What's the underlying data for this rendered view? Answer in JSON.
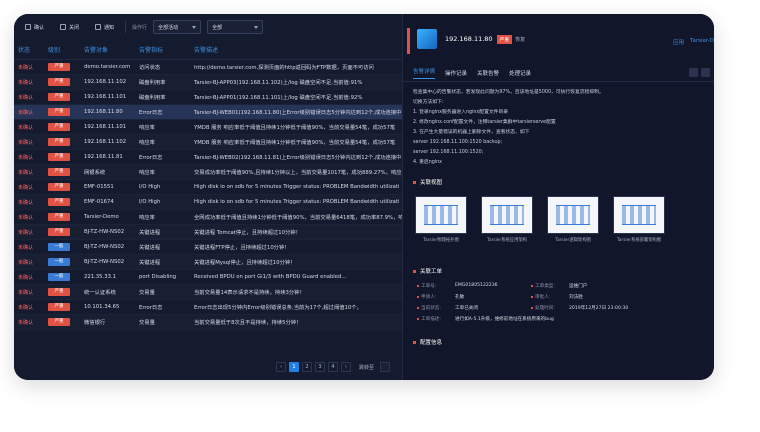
{
  "toolbar": {
    "confirm": "确认",
    "close": "关闭",
    "notify": "通知",
    "operate_label": "操作行",
    "filter1": "全部活动",
    "filter2": "全部"
  },
  "table": {
    "headers": [
      "状态",
      "级别",
      "告警对象",
      "告警指标",
      "告警描述"
    ],
    "rows": [
      {
        "status": "未确认",
        "level": "严重",
        "level_kind": "r",
        "object": "demo.tarsier.com",
        "metric": "访问状态",
        "desc": "http://demo.tarsier.com,探测页面的http返回码为FTP数据，页面不可访问",
        "selected": false
      },
      {
        "status": "未确认",
        "level": "严重",
        "level_kind": "r",
        "object": "192.168.11.102",
        "metric": "磁盘利用率",
        "desc": "Tarsier-BJ-APP03(192.168.11.102)上/log 磁盘空间不足,当前值:91%",
        "selected": false
      },
      {
        "status": "未确认",
        "level": "严重",
        "level_kind": "r",
        "object": "192.168.11.101",
        "metric": "磁盘利用率",
        "desc": "Tarsier-BJ-APP01(192.168.11.101)上/log 磁盘空间不足,当前值:92%",
        "selected": false
      },
      {
        "status": "未确认",
        "level": "严重",
        "level_kind": "r",
        "object": "192.168.11.80",
        "metric": "Error日志",
        "desc": "Tarsier-BJ-WEB01(192.168.11.80)上Error级别错误日志5分钟内达到12个,成功连接中...",
        "selected": true
      },
      {
        "status": "未确认",
        "level": "严重",
        "level_kind": "r",
        "object": "192.168.11.101",
        "metric": "响应率",
        "desc": "YMDB 服务 响应率低于阈值且持续1分钟低于阈值90%，当前交易量54笔，成功57笔",
        "selected": false
      },
      {
        "status": "未确认",
        "level": "严重",
        "level_kind": "r",
        "object": "192.168.11.102",
        "metric": "响应率",
        "desc": "YMDB 服务 响应率低于阈值且持续1分钟低于阈值90%，当前交易量54笔，成功57笔",
        "selected": false
      },
      {
        "status": "未确认",
        "level": "严重",
        "level_kind": "r",
        "object": "192.168.11.81",
        "metric": "Error日志",
        "desc": "Tarsier-BJ-WEB02(192.168.11.81)上Error级别错误日志5分钟内达到12个,成功连接中...",
        "selected": false
      },
      {
        "status": "未确认",
        "level": "严重",
        "level_kind": "r",
        "object": "网银系统",
        "metric": "响应率",
        "desc": "交易成功率低于阈值90%,且持续1分钟以上，当前交易量1017笔，成功889.27%，响应",
        "selected": false
      },
      {
        "status": "未确认",
        "level": "严重",
        "level_kind": "r",
        "object": "EMF-01551",
        "metric": "I/O High",
        "desc": "High disk io on sdb for 5 minutes Trigger status: PROBLEM Bandwidth utilizati",
        "selected": false
      },
      {
        "status": "未确认",
        "level": "严重",
        "level_kind": "r",
        "object": "EMF-01674",
        "metric": "I/O High",
        "desc": "High disk io on sdb for 5 minutes Trigger status: PROBLEM Bandwidth utilizati",
        "selected": false
      },
      {
        "status": "未确认",
        "level": "严重",
        "level_kind": "r",
        "object": "Tarsier-Demo",
        "metric": "响应率",
        "desc": "全网成功率低于阈值且持续1分钟低于阈值90%，当前交易量6418笔，成功率87.9%，响",
        "selected": false
      },
      {
        "status": "未确认",
        "level": "严重",
        "level_kind": "r",
        "object": "BJ-TZ-HW-NS02",
        "metric": "关键进程",
        "desc": "关键进程 Tomcat停止，且持续超过10分钟！",
        "selected": false
      },
      {
        "status": "未确认",
        "level": "一般",
        "level_kind": "b",
        "object": "BJ-TZ-HW-NS02",
        "metric": "关键进程",
        "desc": "关键进程FTP停止，且持续超过10分钟！",
        "selected": false
      },
      {
        "status": "未确认",
        "level": "一般",
        "level_kind": "b",
        "object": "BJ-TZ-HW-NS02",
        "metric": "关键进程",
        "desc": "关键进程Mysql停止，且持续超过10分钟！",
        "selected": false
      },
      {
        "status": "未确认",
        "level": "一般",
        "level_kind": "b",
        "object": "221.35.33.1",
        "metric": "port Disabling",
        "desc": "Received BPDU on port Gi1/3 with BPDU Guard enabled...",
        "selected": false
      },
      {
        "status": "未确认",
        "level": "严重",
        "level_kind": "r",
        "object": "统一认证系统",
        "metric": "交易量",
        "desc": "当前交易量14表示请求不是持续，持续3分钟！",
        "selected": false
      },
      {
        "status": "未确认",
        "level": "严重",
        "level_kind": "r",
        "object": "10.101.34.65",
        "metric": "Error日志",
        "desc": "Error日志出现5分钟内Error级别错误总条,当前为17个,超过阈值10个。",
        "selected": false
      },
      {
        "status": "未确认",
        "level": "严重",
        "level_kind": "r",
        "object": "微信银行",
        "metric": "交易量",
        "desc": "当前交易量低于8次且不是持续，持续5分钟！",
        "selected": false
      }
    ]
  },
  "pager": {
    "pages": [
      "1",
      "2",
      "3",
      "4"
    ],
    "active": "1",
    "jump_label": "跳转至"
  },
  "detail": {
    "host": "192.168.11.80",
    "severity": "严重",
    "status": "恢复",
    "link1": "应用",
    "link2": "Tarsier-D",
    "tabs": [
      "告警详情",
      "操作记录",
      "关联告警",
      "处理记录"
    ],
    "steps": [
      "检查集中心的告警状态，若发现此问题为97%，且该地址是5000，可执行恢复流程抑制。",
      "切换方法如下:",
      "1. 登录nginx服务器进入nginx配置文件目录",
      "2. 修改nginx.conf配置文件，注释tarsier集群中tarsierserve配置",
      "3. 在产生大量错误的机器上删除文件，查看状态，如下",
      "server 192.168.11.100:1520 backup;",
      "server 192.168.11.100:1520;",
      "4. 重启nginx"
    ],
    "related_title": "关联视图",
    "thumbs": [
      "Tarsier物理拓扑图",
      "Tarsier系统应用架构",
      "Tarsier逻辑架构图",
      "Tarsier系统部署架构图"
    ],
    "workorder_title": "关联工单",
    "wo": [
      [
        "工单号:",
        "EMG01805122236",
        "工单类型:",
        "运维门户"
      ],
      [
        "申请人:",
        "孔敏",
        "审批人:",
        "刘法胜"
      ],
      [
        "当前状态:",
        "工单已关闭",
        "处理时间:",
        "2019年12月27日 23:00:30"
      ],
      [
        "工单描述:",
        "进行如A-5.1升级，维修前地址在系统原来的bug",
        "",
        ""
      ]
    ],
    "config_title": "配置信息"
  },
  "colors": {
    "accent": "#1f7fe6",
    "critical": "#e05243",
    "normal": "#3a7bd5"
  }
}
